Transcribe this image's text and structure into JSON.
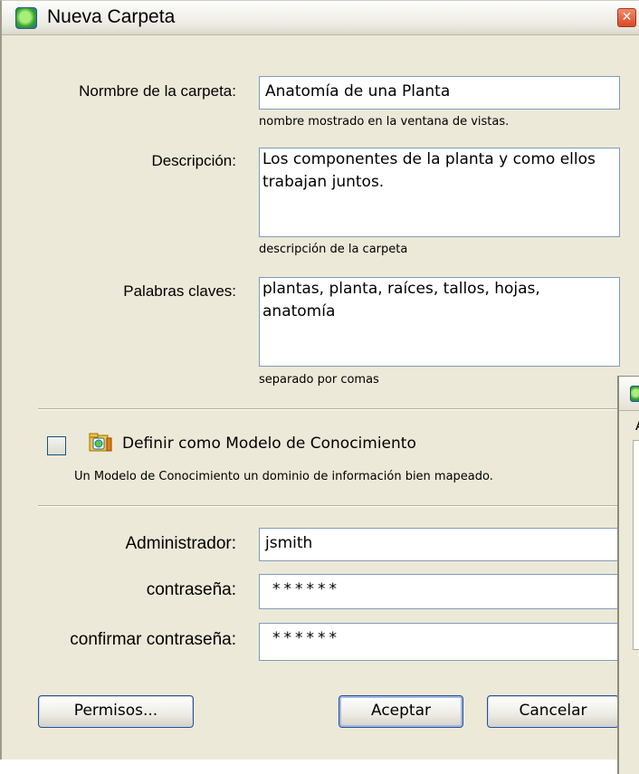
{
  "window": {
    "title": "Nueva Carpeta",
    "close_glyph": "✕"
  },
  "form": {
    "folder_name": {
      "label": "Normbre de la carpeta:",
      "value": "Anatomía de una Planta",
      "hint": "nombre mostrado en la ventana de vistas."
    },
    "description": {
      "label": "Descripción:",
      "value": "Los componentes de la planta y como ellos trabajan juntos.",
      "hint": "descripción de la carpeta"
    },
    "keywords": {
      "label": "Palabras claves:",
      "value": "plantas, planta, raíces, tallos, hojas, anatomía",
      "hint": "separado por comas"
    },
    "knowledge_model": {
      "label": "Definir como Modelo de Conocimiento",
      "checked": false,
      "hint": "Un Modelo de Conocimiento un dominio de información bien mapeado."
    },
    "admin": {
      "label": "Administrador:",
      "value": "jsmith"
    },
    "password": {
      "label": "contraseña:",
      "value": "******"
    },
    "confirm_password": {
      "label": "confirmar contraseña:",
      "value": "******"
    }
  },
  "buttons": {
    "permissions": "Permisos...",
    "accept": "Aceptar",
    "cancel": "Cancelar"
  },
  "background_window": {
    "letter": "A"
  },
  "icons": {
    "app": "app-logo-icon",
    "close": "close-icon",
    "knowledge_model": "knowledge-model-icon"
  },
  "colors": {
    "window_bg": "#ece9d8",
    "field_border": "#7f9db9",
    "button_border": "#2e4e8c",
    "close_button": "#d84a25"
  }
}
